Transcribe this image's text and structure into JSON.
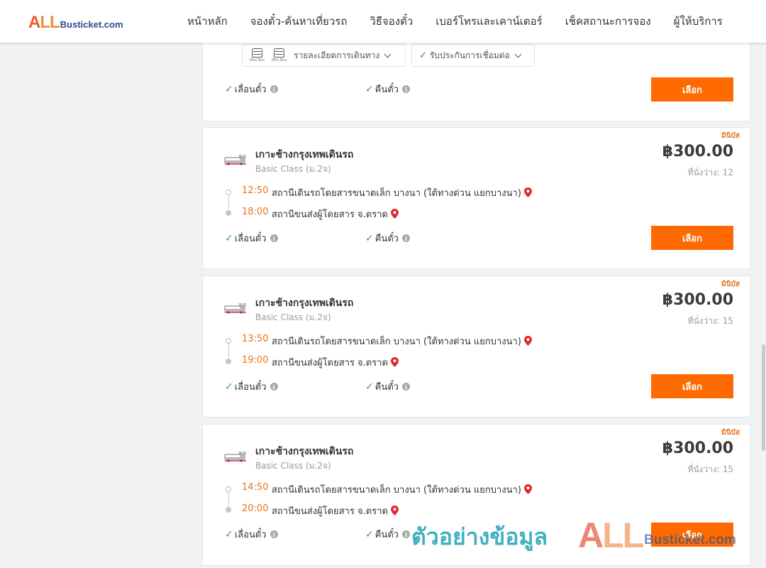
{
  "brand": {
    "logo_all": "ALL",
    "logo_a": "A",
    "logo_ll": "LL",
    "logo_site": "Busticket.com"
  },
  "nav": [
    {
      "label": "หน้าหลัก"
    },
    {
      "label": "จองตั๋ว-ค้นหาเที่ยวรถ"
    },
    {
      "label": "วิธีจองตั๋ว"
    },
    {
      "label": "เบอร์โทรและเคาน์เตอร์"
    },
    {
      "label": "เช็คสถานะการจอง"
    },
    {
      "label": "ผู้ให้บริการ"
    }
  ],
  "top_card": {
    "bus_icon_label": "Mini Bus",
    "route_detail": "รายละเอียดการเดินทาง",
    "connection": "รับประกันการเชื่อมต่อ",
    "feature_change": "เลื่อนตั๋ว",
    "feature_refund": "คืนตั๋ว",
    "select_label": "เลือก"
  },
  "trips": [
    {
      "badge": "มินิบัส",
      "operator": "เกาะช้างกรุงเทพเดินรถ",
      "class": "Basic Class (ม.2จ)",
      "price": "฿300.00",
      "seats": "ที่นั่งว่าง: 12",
      "depart_time": "12:50",
      "depart_place": "สถานีเดินรถโดยสารขนาดเล็ก บางนา (ใต้ทางด่วน แยกบางนา)",
      "arrive_time": "18:00",
      "arrive_place": "สถานีขนส่งผู้โดยสาร จ.ตราด",
      "feature_change": "เลื่อนตั๋ว",
      "feature_refund": "คืนตั๋ว",
      "select_label": "เลือก"
    },
    {
      "badge": "มินิบัส",
      "operator": "เกาะช้างกรุงเทพเดินรถ",
      "class": "Basic Class (ม.2จ)",
      "price": "฿300.00",
      "seats": "ที่นั่งว่าง: 15",
      "depart_time": "13:50",
      "depart_place": "สถานีเดินรถโดยสารขนาดเล็ก บางนา (ใต้ทางด่วน แยกบางนา)",
      "arrive_time": "19:00",
      "arrive_place": "สถานีขนส่งผู้โดยสาร จ.ตราด",
      "feature_change": "เลื่อนตั๋ว",
      "feature_refund": "คืนตั๋ว",
      "select_label": "เลือก"
    },
    {
      "badge": "มินิบัส",
      "operator": "เกาะช้างกรุงเทพเดินรถ",
      "class": "Basic Class (ม.2จ)",
      "price": "฿300.00",
      "seats": "ที่นั่งว่าง: 15",
      "depart_time": "14:50",
      "depart_place": "สถานีเดินรถโดยสารขนาดเล็ก บางนา (ใต้ทางด่วน แยกบางนา)",
      "arrive_time": "20:00",
      "arrive_place": "สถานีขนส่งผู้โดยสาร จ.ตราด",
      "feature_change": "เลื่อนตั๋ว",
      "feature_refund": "คืนตั๋ว",
      "select_label": "เลือก"
    }
  ],
  "watermark": {
    "text": "ตัวอย่างข้อมูล",
    "all_a": "A",
    "all_ll": "LL",
    "site": "Busticket.com"
  },
  "colors": {
    "accent": "#ff6a00",
    "time": "#e8731a",
    "check": "#3aa847",
    "pin": "#e0282e"
  },
  "icons": [
    "mini-bus-icon",
    "chevron-down-icon",
    "check-icon",
    "info-icon",
    "map-pin-icon"
  ]
}
